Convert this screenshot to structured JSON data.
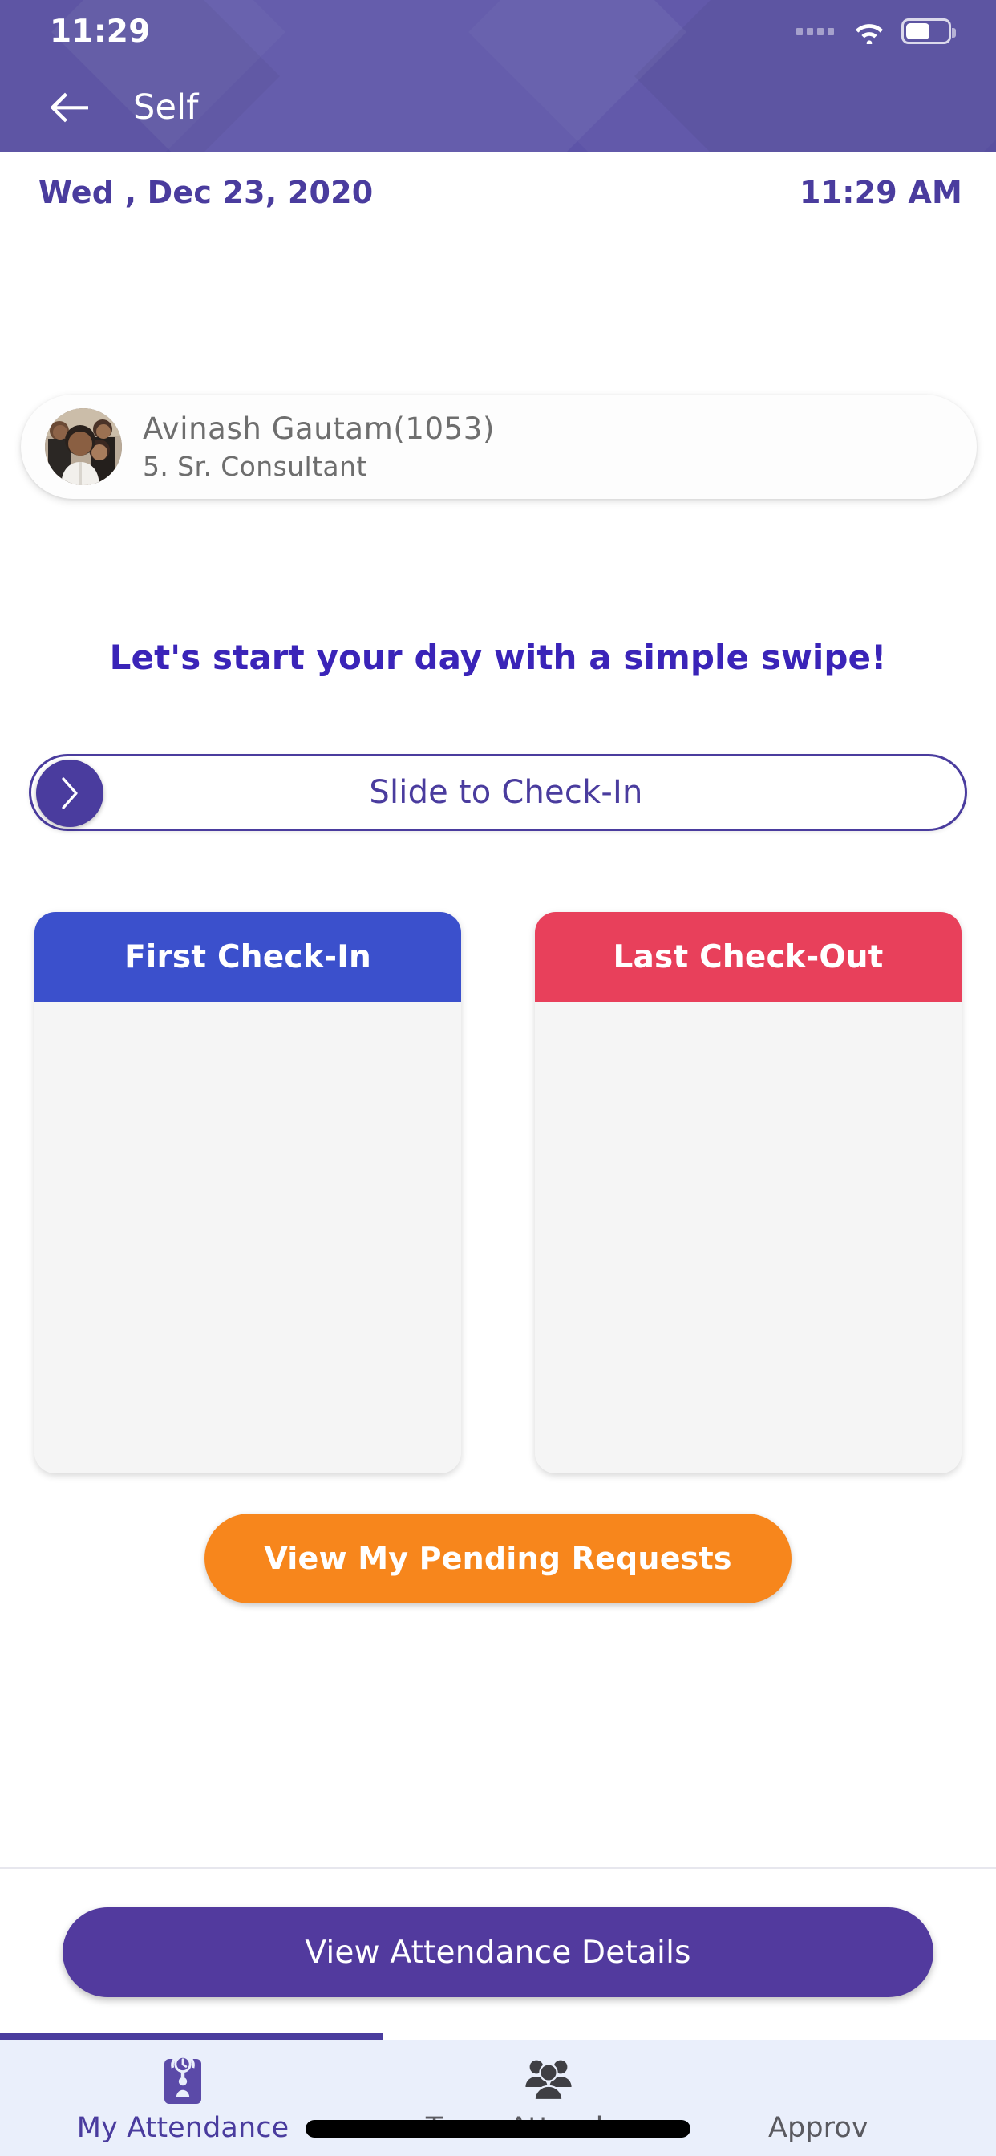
{
  "status_bar": {
    "time": "11:29",
    "wifi_icon": "wifi-icon",
    "battery_icon": "battery-icon",
    "signal_dots_icon": "signal-dots-icon"
  },
  "app_bar": {
    "back_icon": "back-arrow-icon",
    "title": "Self"
  },
  "date_row": {
    "date": "Wed , Dec 23, 2020",
    "time": "11:29 AM"
  },
  "profile": {
    "avatar_icon": "avatar-photo",
    "name": "Avinash Gautam(1053)",
    "role": "5. Sr. Consultant"
  },
  "swipe": {
    "heading": "Let's start your day with a simple swipe!",
    "slider_label": "Slide to Check-In",
    "knob_icon": "chevron-right-icon"
  },
  "cards": [
    {
      "title": "First Check-In",
      "value": "",
      "color": "#3B50CC"
    },
    {
      "title": "Last Check-Out",
      "value": "",
      "color": "#E8405B"
    }
  ],
  "buttons": {
    "pending_requests": "View My Pending Requests",
    "attendance_details": "View Attendance Details"
  },
  "bottom_nav": {
    "tabs": [
      {
        "label": "My Attendance",
        "icon": "attendance-clock-badge-icon",
        "active": true
      },
      {
        "label": "Team Attendance",
        "icon": "people-group-icon",
        "active": false
      },
      {
        "label": "Approv",
        "icon": "approvals-icon",
        "active": false
      }
    ]
  },
  "colors": {
    "header_purple": "#5D54A8",
    "accent_purple": "#4A3C9E",
    "heading_indigo": "#3A24B8",
    "check_in_blue": "#3B50CC",
    "check_out_red": "#E8405B",
    "orange": "#F7861C",
    "button_purple": "#523A9E",
    "nav_background": "#EAEFFB"
  }
}
